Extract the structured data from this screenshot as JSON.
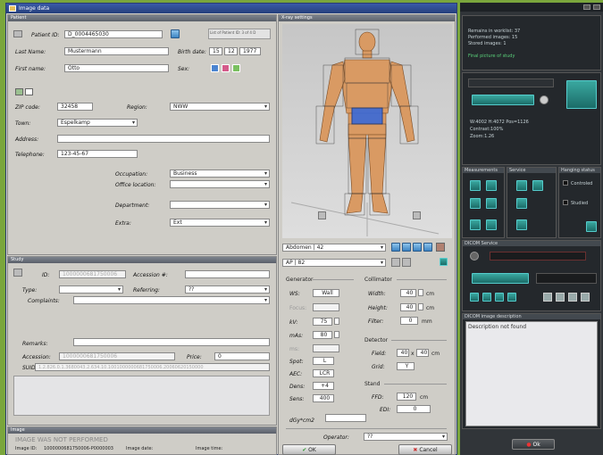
{
  "window": {
    "title": "Image data"
  },
  "patient": {
    "section": "Patient",
    "id_label": "Patient ID:",
    "id_value": "D_0004465030",
    "note": "List of Patient ID: 3 of 4 D",
    "last_name_label": "Last Name:",
    "last_name": "Mustermann",
    "first_name_label": "First name:",
    "first_name": "Otto",
    "birth_label": "Birth date:",
    "birth_day": "15",
    "birth_month": "12",
    "birth_year": "1977",
    "sex_label": "Sex:",
    "zip_label": "ZIP code:",
    "zip": "32458",
    "region_label": "Region:",
    "region": "NWW",
    "town_label": "Town:",
    "town": "Espelkamp",
    "address_label": "Address:",
    "telephone_label": "Telephone:",
    "telephone": "123-45-67",
    "occupation_label": "Occupation:",
    "occupation": "Business",
    "office_label": "Office location:",
    "department_label": "Department:",
    "extra_label": "Extra:",
    "extra": "Ext"
  },
  "study": {
    "section": "Study",
    "id_label": "ID:",
    "id_value": "1000000681750006",
    "accession_label": "Accession #:",
    "type_label": "Type:",
    "referring_label": "Referring:",
    "referring": "??",
    "complaints_label": "Complaints:",
    "remarks_label": "Remarks:",
    "accession2_label": "Accession:",
    "accession2_value": "1000000681750006",
    "price_label": "Price:",
    "price": "0",
    "suid_label": "SUID:",
    "suid": "1.2.826.0.1.3680043.2.634.10.1001000000681750006.20060620150000"
  },
  "image": {
    "section": "Image",
    "status": "IMAGE WAS NOT PERFORMED",
    "image_id_label": "Image ID:",
    "image_id": "1000000681750006-P0000003",
    "date_label": "Image date:",
    "time_label": "Image time:"
  },
  "xray": {
    "section": "X-ray settings",
    "protocol": "Abdomen | 42",
    "projection": "AP | 82"
  },
  "generator": {
    "title": "Generator",
    "ws_label": "WS:",
    "ws": "Wall",
    "focus_label": "Focus:",
    "kv_label": "kV:",
    "kv": "75",
    "mas_label": "mAs:",
    "mas": "80",
    "ms_label": "ms:",
    "spot_label": "Spot:",
    "spot": "L",
    "aec_label": "AEC:",
    "aec": "LCR",
    "dens_label": "Dens:",
    "dens": "+4",
    "sens_label": "Sens:",
    "sens": "400",
    "dose_label": "dGy*cm2"
  },
  "collimator": {
    "title": "Collimator",
    "width_label": "Width:",
    "width": "40",
    "height_label": "Height:",
    "height": "40",
    "filter_label": "Filter:",
    "filter": "0",
    "unit_cm": "cm",
    "unit_mm": "mm"
  },
  "detector": {
    "title": "Detector",
    "field_label": "Field:",
    "field_w": "40",
    "field_x": "x",
    "field_h": "40",
    "unit": "cm",
    "grid_label": "Grid:",
    "grid": "Y"
  },
  "stand": {
    "title": "Stand",
    "ffd_label": "FFD:",
    "ffd": "120",
    "unit": "cm",
    "edi_label": "EDI:",
    "edi": "0"
  },
  "operator": {
    "label": "Operator:",
    "value": "??"
  },
  "buttons": {
    "ok": "OK",
    "cancel": "Cancel",
    "right_ok": "Ok"
  },
  "rightpanel": {
    "info1": "Remains in worklist: 37",
    "info2": "Performed images: 15",
    "info3": "Stored images: 1",
    "info4": "Final picture of study",
    "readout1": "W:4002    H:4072    Pos=1126",
    "readout2": "Contrast:100%",
    "readout3": "Zoom:1.26",
    "hdr_measure": "Measurements",
    "hdr_service": "Service",
    "hdr_hanging": "Hanging status",
    "opt1": "Controled",
    "opt2": "Studied",
    "dicom_service": "DICOM Service",
    "dicom_desc": "DICOM image description",
    "desc_text": "Description not found"
  },
  "colors": {
    "accent": "#2a5a8a",
    "titlebar": "#25407c",
    "teal": "#3aa8a0",
    "desktop": "#7aa63c"
  }
}
